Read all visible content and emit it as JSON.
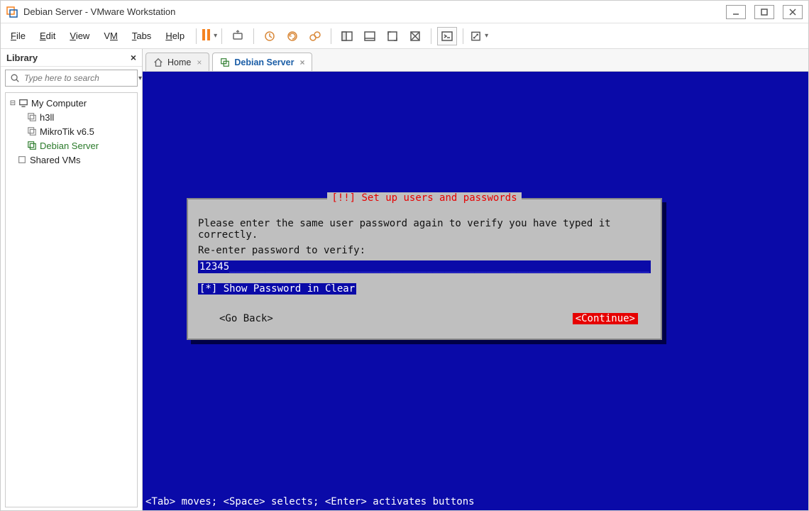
{
  "window": {
    "title": "Debian Server - VMware Workstation"
  },
  "menu": {
    "file": "File",
    "edit": "Edit",
    "view": "View",
    "vm": "VM",
    "tabs": "Tabs",
    "help": "Help"
  },
  "library": {
    "title": "Library",
    "search_placeholder": "Type here to search",
    "root": "My Computer",
    "items": [
      "h3ll",
      "MikroTik v6.5",
      "Debian Server"
    ],
    "shared": "Shared VMs"
  },
  "tabs": {
    "home": "Home",
    "active": "Debian Server"
  },
  "installer": {
    "title": "[!!] Set up users and passwords",
    "instruction": "Please enter the same user password again to verify you have typed it correctly.",
    "prompt": "Re-enter password to verify:",
    "password_value": "12345",
    "show_pw": "[*]  Show Password in Clear",
    "go_back": "<Go Back>",
    "continue": "<Continue>"
  },
  "statusbar": "<Tab> moves; <Space> selects; <Enter> activates buttons"
}
